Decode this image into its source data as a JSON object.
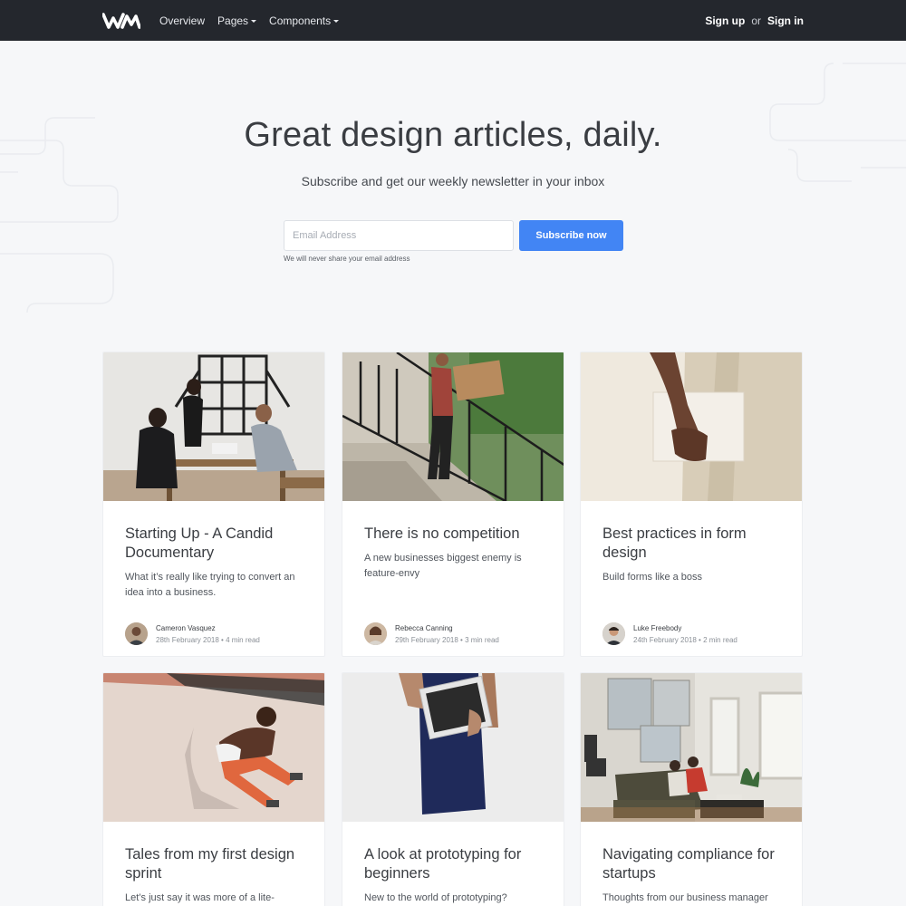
{
  "navbar": {
    "logo_icon": "wm-logo-icon",
    "links": [
      {
        "label": "Overview",
        "dropdown": false
      },
      {
        "label": "Pages",
        "dropdown": true
      },
      {
        "label": "Components",
        "dropdown": true
      }
    ],
    "signup_label": "Sign up",
    "or_label": "or",
    "signin_label": "Sign in"
  },
  "hero": {
    "title": "Great design articles, daily.",
    "subtitle": "Subscribe and get our weekly newsletter in your inbox",
    "email_placeholder": "Email Address",
    "email_value": "",
    "subscribe_label": "Subscribe now",
    "note": "We will never share your email address"
  },
  "colors": {
    "navbar_bg": "#24272d",
    "accent": "#4285f4",
    "page_bg": "#f6f7f9"
  },
  "cards": [
    {
      "title": "Starting Up - A Candid Documentary",
      "description": "What it’s really like trying to convert an idea into a business.",
      "author": "Cameron Vasquez",
      "meta": "28th February 2018 • 4 min read",
      "image": "office-meeting-photo"
    },
    {
      "title": "There is no competition",
      "description": "A new businesses biggest enemy is feature-envy",
      "author": "Rebecca Canning",
      "meta": "29th February 2018 • 3 min read",
      "image": "stairs-box-photo"
    },
    {
      "title": "Best practices in form design",
      "description": "Build forms like a boss",
      "author": "Luke Freebody",
      "meta": "24th February 2018 • 2 min read",
      "image": "notebook-hand-photo"
    },
    {
      "title": "Tales from my first design sprint",
      "description": "Let’s just say it was more of a lite-",
      "image": "sand-runner-photo"
    },
    {
      "title": "A look at prototyping for beginners",
      "description": "New to the world of prototyping?",
      "image": "tablet-dress-photo"
    },
    {
      "title": "Navigating compliance for startups",
      "description": "Thoughts from our business manager",
      "image": "living-room-photo"
    }
  ]
}
